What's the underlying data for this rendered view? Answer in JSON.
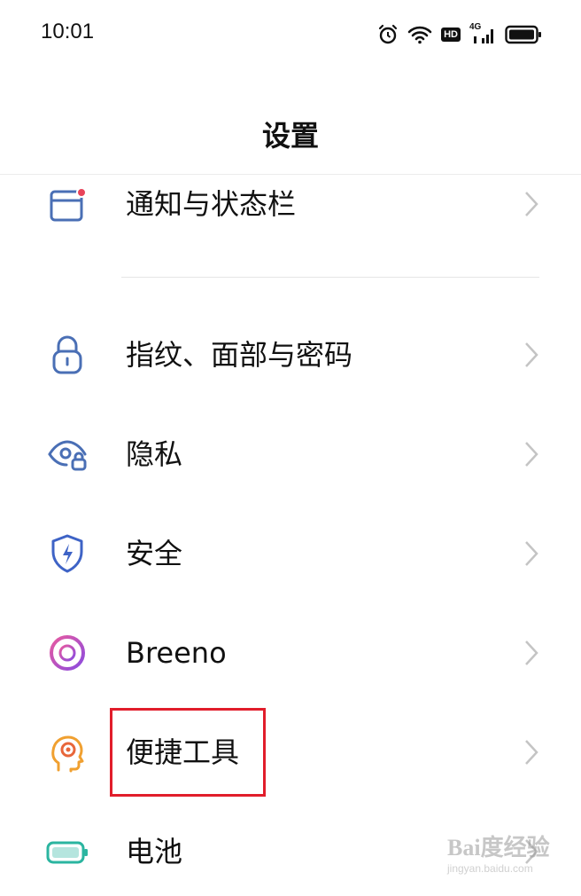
{
  "status_bar": {
    "time": "10:01",
    "icons": [
      "alarm-icon",
      "wifi-icon",
      "hd-badge",
      "cellular-4g-icon",
      "battery-icon"
    ],
    "hd_label": "HD",
    "network_label": "4G"
  },
  "header": {
    "title": "设置"
  },
  "settings": {
    "items": [
      {
        "label": "通知与状态栏",
        "icon": "notification-icon",
        "icon_color": "#4a6fb5"
      },
      {
        "label": "指纹、面部与密码",
        "icon": "lock-icon",
        "icon_color": "#4a6fb5"
      },
      {
        "label": "隐私",
        "icon": "privacy-eye-icon",
        "icon_color": "#4a6fb5"
      },
      {
        "label": "安全",
        "icon": "security-shield-icon",
        "icon_color": "#3e63c6"
      },
      {
        "label": "Breeno",
        "icon": "breeno-icon",
        "icon_color": "#c046d6"
      },
      {
        "label": "便捷工具",
        "icon": "convenience-tools-icon",
        "icon_color": "#f0a030"
      },
      {
        "label": "电池",
        "icon": "battery-settings-icon",
        "icon_color": "#2bb5a0"
      }
    ]
  },
  "highlight_color": "#e11d2b",
  "watermark": {
    "brand": "Bai度经验",
    "url": "jingyan.baidu.com"
  }
}
